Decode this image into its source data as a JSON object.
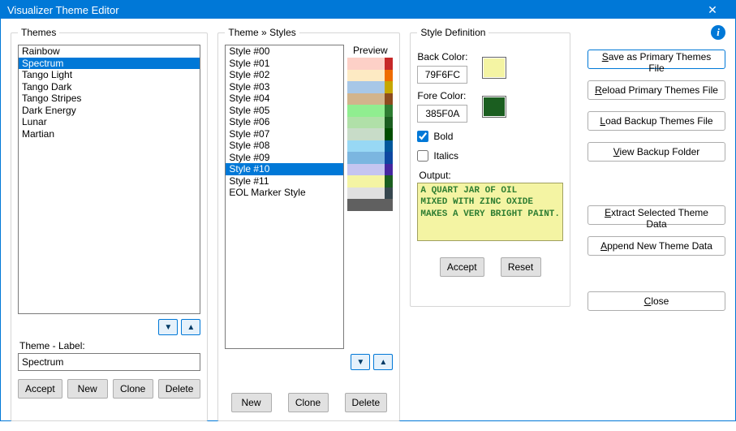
{
  "window": {
    "title": "Visualizer Theme Editor"
  },
  "themes": {
    "legend": "Themes",
    "items": [
      "Rainbow",
      "Spectrum",
      "Tango Light",
      "Tango Dark",
      "Tango Stripes",
      "Dark Energy",
      "Lunar",
      "Martian"
    ],
    "selected_index": 1,
    "label_caption": "Theme - Label:",
    "label_value": "Spectrum",
    "buttons": {
      "accept": "Accept",
      "new": "New",
      "clone": "Clone",
      "delete": "Delete"
    },
    "arrows": {
      "down": "▼",
      "up": "▲"
    }
  },
  "styles": {
    "legend": "Theme » Styles",
    "preview_label": "Preview",
    "items": [
      "Style #00",
      "Style #01",
      "Style #02",
      "Style #03",
      "Style #04",
      "Style #05",
      "Style #06",
      "Style #07",
      "Style #08",
      "Style #09",
      "Style #10",
      "Style #11",
      "EOL Marker Style"
    ],
    "selected_index": 10,
    "swatches": [
      {
        "a": "#fdd0c7",
        "b": "#c62828"
      },
      {
        "a": "#fdeac3",
        "b": "#ef6c00"
      },
      {
        "a": "#a7c7e7",
        "b": "#c6a700"
      },
      {
        "a": "#d2b48c",
        "b": "#8d4b1e"
      },
      {
        "a": "#90ee90",
        "b": "#2e7d32"
      },
      {
        "a": "#b0e0a8",
        "b": "#1b5e20"
      },
      {
        "a": "#c8dcc8",
        "b": "#004d00"
      },
      {
        "a": "#98d8f4",
        "b": "#01579b"
      },
      {
        "a": "#7bb6e0",
        "b": "#0d47a1"
      },
      {
        "a": "#c5c5f0",
        "b": "#4527a0"
      },
      {
        "a": "#f4f4a3",
        "b": "#1b5e20"
      },
      {
        "a": "#e0e0e0",
        "b": "#37474f"
      },
      {
        "a": "#606060",
        "b": "#606060"
      }
    ],
    "buttons": {
      "new": "New",
      "clone": "Clone",
      "delete": "Delete"
    },
    "arrows": {
      "down": "▼",
      "up": "▲"
    }
  },
  "definition": {
    "legend": "Style Definition",
    "back_color_label": "Back Color:",
    "back_color_value": "79F6FC",
    "back_color_swatch": "#f4f4a3",
    "fore_color_label": "Fore Color:",
    "fore_color_value": "385F0A",
    "fore_color_swatch": "#1b5e20",
    "bold_label": "Bold",
    "bold_checked": true,
    "italics_label": "Italics",
    "italics_checked": false,
    "output_label": "Output:",
    "output_text": "A QUART JAR OF OIL\nMIXED WITH ZINC OXIDE\nMAKES A VERY BRIGHT PAINT.",
    "output_back": "#f4f4a3",
    "output_fore": "#2e7d32",
    "buttons": {
      "accept": "Accept",
      "reset": "Reset"
    }
  },
  "actions": {
    "save_primary": "Save as Primary Themes File",
    "reload_primary": "Reload Primary Themes File",
    "load_backup": "Load Backup Themes File",
    "view_backup": "View Backup Folder",
    "extract": "Extract Selected Theme Data",
    "append": "Append New Theme Data",
    "close": "Close",
    "underline": {
      "save_primary": "S",
      "reload_primary": "R",
      "load_backup": "L",
      "view_backup": "V",
      "extract": "E",
      "append": "A",
      "close": "C"
    }
  },
  "icons": {
    "info": "i",
    "close_window": "✕"
  }
}
